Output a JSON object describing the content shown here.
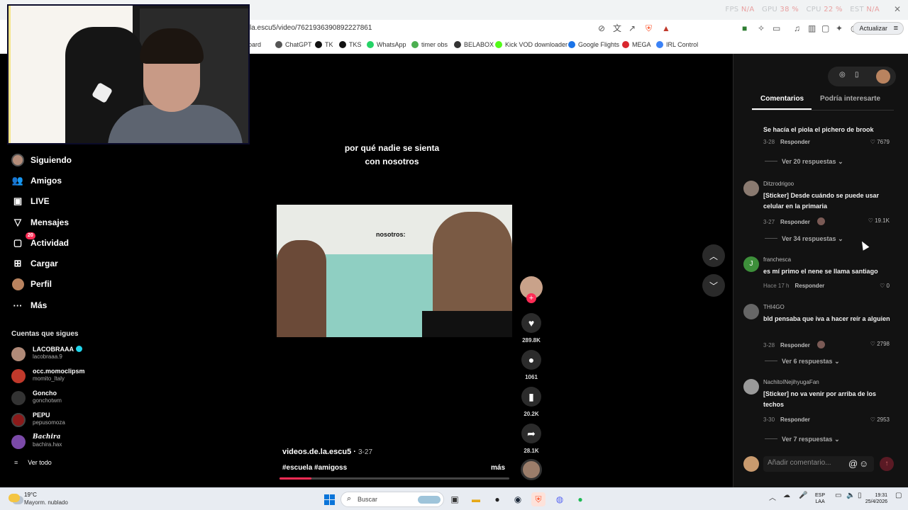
{
  "browser": {
    "url": "la.escu5/video/7621936390892227861",
    "update_label": "Actualizar",
    "stats": {
      "fps_label": "FPS",
      "fps_value": "N/A",
      "gpu_label": "GPU",
      "gpu_value": "38 %",
      "cpu_label": "CPU",
      "cpu_value": "22 %",
      "est_label": "EST",
      "est_value": "N/A"
    },
    "bookmarks": [
      {
        "label": "hboard",
        "color": "#888888"
      },
      {
        "label": "ChatGPT",
        "color": "#555555"
      },
      {
        "label": "TK",
        "color": "#111111"
      },
      {
        "label": "TKS",
        "color": "#111111"
      },
      {
        "label": "WhatsApp",
        "color": "#25d366"
      },
      {
        "label": "timer obs",
        "color": "#4caf50"
      },
      {
        "label": "BELABOX",
        "color": "#333333"
      },
      {
        "label": "Kick VOD downloader",
        "color": "#53fc18"
      },
      {
        "label": "Google Flights",
        "color": "#1a73e8"
      },
      {
        "label": "MEGA",
        "color": "#d9272e"
      },
      {
        "label": "IRL Control",
        "color": "#3b82f6"
      }
    ]
  },
  "sidebar": {
    "nav": [
      {
        "label": "Siguiendo",
        "icon": "following-icon"
      },
      {
        "label": "Amigos",
        "icon": "friends-icon"
      },
      {
        "label": "LIVE",
        "icon": "live-icon"
      },
      {
        "label": "Mensajes",
        "icon": "messages-icon"
      },
      {
        "label": "Actividad",
        "icon": "activity-icon",
        "badge": "20"
      },
      {
        "label": "Cargar",
        "icon": "upload-icon"
      },
      {
        "label": "Perfil",
        "icon": "profile-icon"
      },
      {
        "label": "Más",
        "icon": "more-icon"
      }
    ],
    "following_title": "Cuentas que sigues",
    "accounts": [
      {
        "name": "LACOBRAAA",
        "handle": "lacobraaa.9",
        "verified": true,
        "color": "#b08a78"
      },
      {
        "name": "occ.momoclipsm",
        "handle": "momito_ltaly",
        "verified": false,
        "color": "#c0392b"
      },
      {
        "name": "Goncho",
        "handle": "gonchotwm",
        "verified": false,
        "color": "#333333"
      },
      {
        "name": "PEPU",
        "handle": "pepusomoza",
        "verified": false,
        "color": "#8b1a1a"
      },
      {
        "name": "Bachira",
        "handle": "bachira.hax",
        "verified": false,
        "color": "#7b4aa8"
      }
    ],
    "see_all": "Ver todo"
  },
  "video": {
    "overlay_text_line1": "por qué nadie se sienta",
    "overlay_text_line2": "con nosotros",
    "frame_text": "nosotros:",
    "author": "videos.de.la.escu5",
    "date": "3-27",
    "tags": "#escuela #amigoss",
    "more": "más",
    "progress": 0.14,
    "counts": {
      "likes": "289.8K",
      "comments": "1061",
      "saves": "20.2K",
      "shares": "28.1K"
    }
  },
  "comments_panel": {
    "tabs": [
      "Comentarios",
      "Podría interesarte"
    ],
    "first_text": "Se hacía el piola el pichero de brook",
    "first_date": "3-28",
    "first_likes": "7679",
    "reply_label": "Responder",
    "first_replies": "Ver 20 respuestas",
    "comments": [
      {
        "user": "Ditzrodrigoo",
        "text": "[Sticker] Desde cuándo se puede usar celular en la primaria",
        "date": "3-27",
        "likes": "19.1K",
        "replies": "Ver 34 respuestas",
        "color": "#8a7a70"
      },
      {
        "user": "franchesca",
        "text": "es mí primo el nene se llama santiago",
        "date": "Hace 17 h",
        "likes": "0",
        "replies": "",
        "color": "#3d8f3a",
        "initial": "J"
      },
      {
        "user": "THI4GO",
        "text": "bld pensaba que iva a hacer reír a alguien",
        "date": "3-28",
        "likes": "2798",
        "replies": "Ver 6 respuestas",
        "color": "#666666"
      },
      {
        "user": "NachitoINejihyugaFan",
        "text": "[Sticker] no va venir por arriba de los techos",
        "date": "3-30",
        "likes": "2953",
        "replies": "Ver 7 respuestas",
        "color": "#9a9a9a"
      }
    ],
    "input_placeholder": "Añadir comentario..."
  },
  "taskbar": {
    "temp": "19°C",
    "weather": "Mayorm. nublado",
    "search": "Buscar",
    "lang_line1": "ESP",
    "lang_line2": "LAA",
    "time": "19:31",
    "date": "25/4/2026"
  }
}
